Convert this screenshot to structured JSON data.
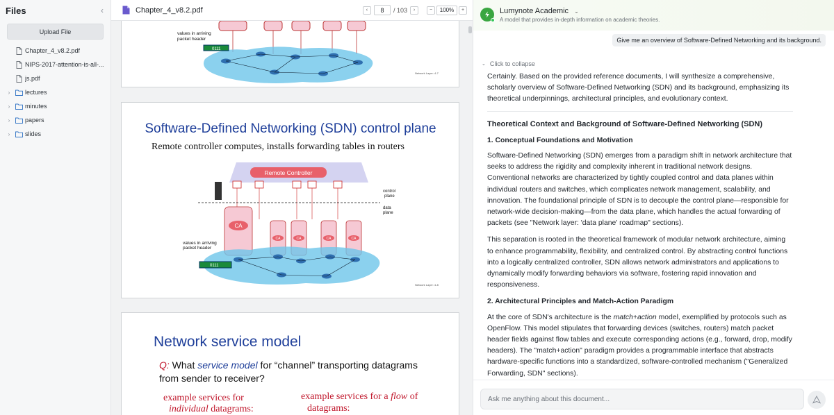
{
  "sidebar": {
    "title": "Files",
    "upload_label": "Upload File",
    "files": [
      {
        "name": "Chapter_4_v8.2.pdf"
      },
      {
        "name": "NIPS-2017-attention-is-all-..."
      },
      {
        "name": "js.pdf"
      }
    ],
    "folders": [
      {
        "name": "lectures"
      },
      {
        "name": "minutes"
      },
      {
        "name": "papers"
      },
      {
        "name": "slides"
      }
    ]
  },
  "viewer": {
    "filename": "Chapter_4_v8.2.pdf",
    "page_current": "8",
    "page_total": "/ 103",
    "zoom": "100%",
    "page_a": {
      "label_values": "values in arriving",
      "label_header": "packet header",
      "header_value": "0111",
      "footer": "Network Layer: 4-7"
    },
    "page_b": {
      "title": "Software-Defined Networking (SDN) control plane",
      "subtitle": "Remote controller computes, installs forwarding tables in routers",
      "controller": "Remote Controller",
      "ca_large": "CA",
      "ca_small": "CA",
      "control_plane": [
        "control",
        "plane"
      ],
      "data_plane": [
        "data",
        "plane"
      ],
      "label_values": "values in arriving",
      "label_header": "packet header",
      "header_value": "0111",
      "footer": "Network Layer: 4-8"
    },
    "page_c": {
      "title": "Network service model",
      "q_label": "Q:",
      "q_text_1": " What ",
      "q_em": "service model",
      "q_text_2": " for “channel” transporting datagrams",
      "q_line2": "from sender to receiver?",
      "left_1": "example services for",
      "left_2_em": "individual",
      "left_2_rest": " datagrams:",
      "right_1_a": "example services for a ",
      "right_1_em": "flow",
      "right_1_b": " of",
      "right_2": "datagrams:"
    }
  },
  "chat": {
    "model_name": "Lumynote Academic",
    "model_desc": "A model that provides in-depth information on academic theories.",
    "user_message": "Give me an overview of Software-Defined Networking and its background.",
    "collapse_label": "Click to collapse",
    "intro": "Certainly. Based on the provided reference documents, I will synthesize a comprehensive, scholarly overview of Software-Defined Networking (SDN) and its background, emphasizing its theoretical underpinnings, architectural principles, and evolutionary context.",
    "heading": "Theoretical Context and Background of Software-Defined Networking (SDN)",
    "s1_heading": "1. Conceptual Foundations and Motivation",
    "s1_p1": "Software-Defined Networking (SDN) emerges from a paradigm shift in network architecture that seeks to address the rigidity and complexity inherent in traditional network designs. Conventional networks are characterized by tightly coupled control and data planes within individual routers and switches, which complicates network management, scalability, and innovation. The foundational principle of SDN is to decouple the control plane—responsible for network-wide decision-making—from the data plane, which handles the actual forwarding of packets (see \"Network layer: 'data plane' roadmap\" sections).",
    "s1_p2": "This separation is rooted in the theoretical framework of modular network architecture, aiming to enhance programmability, flexibility, and centralized control. By abstracting control functions into a logically centralized controller, SDN allows network administrators and applications to dynamically modify forwarding behaviors via software, fostering rapid innovation and responsiveness.",
    "s2_heading": "2. Architectural Principles and Match-Action Paradigm",
    "s2_p1_a": "At the core of SDN's architecture is the ",
    "s2_p1_em": "match+action",
    "s2_p1_b": " model, exemplified by protocols such as OpenFlow. This model stipulates that forwarding devices (switches, routers) match packet header fields against flow tables and execute corresponding actions (e.g., forward, drop, modify headers). The \"match+action\" paradigm provides a programmable interface that abstracts hardware-specific functions into a standardized, software-controlled mechanism (\"Generalized Forwarding, SDN\" sections).",
    "input_placeholder": "Ask me anything about this document..."
  },
  "colors": {
    "accent_green": "#3aa641",
    "slide_blue": "#1f3f9a",
    "slide_red": "#c0152a",
    "controller_pink": "#e8606a"
  }
}
